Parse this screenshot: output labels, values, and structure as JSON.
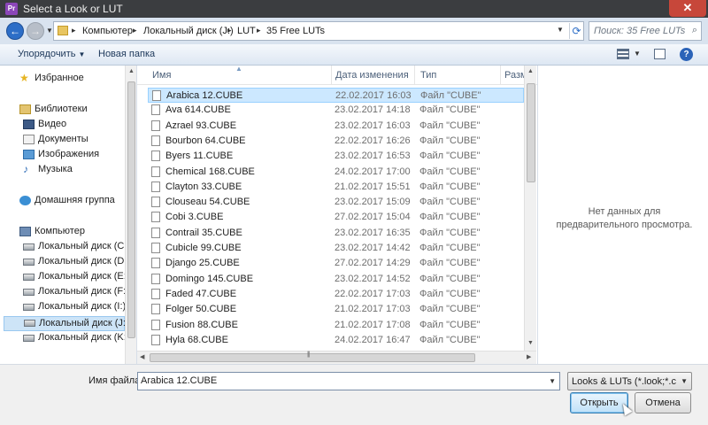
{
  "window": {
    "title": "Select a Look or LUT",
    "app_icon": "Pr",
    "close_label": "✕"
  },
  "address": {
    "crumbs": [
      "Компьютер",
      "Локальный диск (J:)",
      "LUT",
      "35 Free LUTs"
    ],
    "search_placeholder": "Поиск: 35 Free LUTs"
  },
  "toolbar": {
    "organize_label": "Упорядочить",
    "new_folder_label": "Новая папка",
    "help_label": "?"
  },
  "sidebar": {
    "favorites": "Избранное",
    "libraries": "Библиотеки",
    "video": "Видео",
    "documents": "Документы",
    "images": "Изображения",
    "music": "Музыка",
    "homegroup": "Домашняя группа",
    "computer": "Компьютер",
    "drives": [
      "Локальный диск (C:)",
      "Локальный диск (D:)",
      "Локальный диск (E:)",
      "Локальный диск (F:)",
      "Локальный диск (I:)",
      "Локальный диск (J:)",
      "Локальный диск (K:)"
    ],
    "selected_drive_index": 5
  },
  "columns": {
    "name": "Имя",
    "date": "Дата изменения",
    "type": "Тип",
    "size": "Разм"
  },
  "files": [
    {
      "name": "Arabica 12.CUBE",
      "date": "22.02.2017 16:03",
      "type": "Файл \"CUBE\""
    },
    {
      "name": "Ava 614.CUBE",
      "date": "23.02.2017 14:18",
      "type": "Файл \"CUBE\""
    },
    {
      "name": "Azrael 93.CUBE",
      "date": "23.02.2017 16:03",
      "type": "Файл \"CUBE\""
    },
    {
      "name": "Bourbon 64.CUBE",
      "date": "22.02.2017 16:26",
      "type": "Файл \"CUBE\""
    },
    {
      "name": "Byers 11.CUBE",
      "date": "23.02.2017 16:53",
      "type": "Файл \"CUBE\""
    },
    {
      "name": "Chemical 168.CUBE",
      "date": "24.02.2017 17:00",
      "type": "Файл \"CUBE\""
    },
    {
      "name": "Clayton 33.CUBE",
      "date": "21.02.2017 15:51",
      "type": "Файл \"CUBE\""
    },
    {
      "name": "Clouseau 54.CUBE",
      "date": "23.02.2017 15:09",
      "type": "Файл \"CUBE\""
    },
    {
      "name": "Cobi 3.CUBE",
      "date": "27.02.2017 15:04",
      "type": "Файл \"CUBE\""
    },
    {
      "name": "Contrail 35.CUBE",
      "date": "23.02.2017 16:35",
      "type": "Файл \"CUBE\""
    },
    {
      "name": "Cubicle 99.CUBE",
      "date": "23.02.2017 14:42",
      "type": "Файл \"CUBE\""
    },
    {
      "name": "Django 25.CUBE",
      "date": "27.02.2017 14:29",
      "type": "Файл \"CUBE\""
    },
    {
      "name": "Domingo 145.CUBE",
      "date": "23.02.2017 14:52",
      "type": "Файл \"CUBE\""
    },
    {
      "name": "Faded 47.CUBE",
      "date": "22.02.2017 17:03",
      "type": "Файл \"CUBE\""
    },
    {
      "name": "Folger 50.CUBE",
      "date": "21.02.2017 17:03",
      "type": "Файл \"CUBE\""
    },
    {
      "name": "Fusion 88.CUBE",
      "date": "21.02.2017 17:08",
      "type": "Файл \"CUBE\""
    },
    {
      "name": "Hyla 68.CUBE",
      "date": "24.02.2017 16:47",
      "type": "Файл \"CUBE\""
    }
  ],
  "selected_file_index": 0,
  "preview": {
    "message": "Нет данных для предварительного просмотра."
  },
  "footer": {
    "filename_label": "Имя файла:",
    "filename_value": "Arabica 12.CUBE",
    "filter_value": "Looks & LUTs (*.look;*.cube;*",
    "open_label": "Открыть",
    "cancel_label": "Отмена"
  },
  "colors": {
    "selection": "#cce8ff",
    "close_button": "#c7473a",
    "open_button_border": "#3c7fb1"
  }
}
